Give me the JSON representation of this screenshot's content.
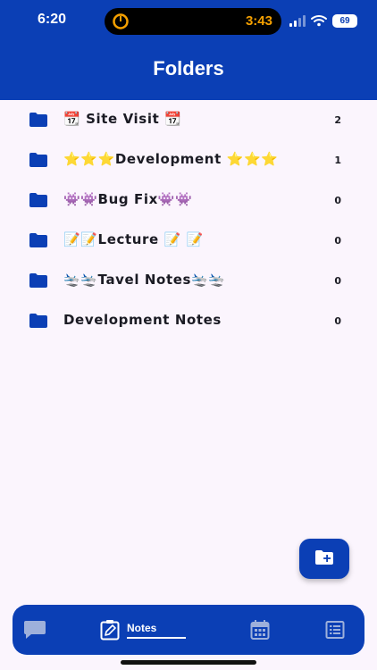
{
  "status": {
    "time": "6:20",
    "timer": "3:43",
    "battery": "69"
  },
  "header": {
    "title": "Folders"
  },
  "folders": [
    {
      "name": "📆 Site Visit 📆",
      "count": "2"
    },
    {
      "name": "⭐⭐⭐Development ⭐⭐⭐",
      "count": "1"
    },
    {
      "name": "👾👾Bug Fix👾👾",
      "count": "0"
    },
    {
      "name": "📝📝Lecture 📝 📝",
      "count": "0"
    },
    {
      "name": "🛬🛬Tavel Notes🛬🛬",
      "count": "0"
    },
    {
      "name": "Development Notes",
      "count": "0"
    }
  ],
  "nav": {
    "notes_label": "Notes"
  },
  "colors": {
    "brand": "#0b3fb5",
    "background": "#fbf5fd",
    "timer": "#f5a000"
  },
  "icons": {
    "folder": "folder-icon",
    "add_folder": "add-folder-icon",
    "chat": "chat-icon",
    "notes": "notes-icon",
    "calendar": "calendar-icon",
    "list": "list-icon"
  }
}
